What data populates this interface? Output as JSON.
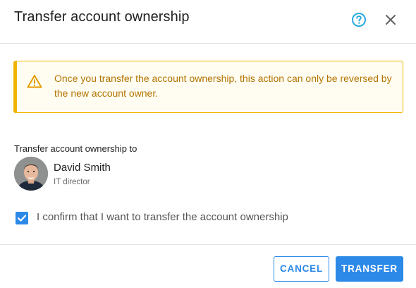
{
  "dialog": {
    "title": "Transfer account ownership",
    "help_icon": "help-circle-icon",
    "close_icon": "close-icon"
  },
  "warning": {
    "icon": "warning-triangle-icon",
    "text": "Once you transfer the account ownership, this action can only be reversed by the new account owner."
  },
  "recipient": {
    "section_label": "Transfer account ownership to",
    "name": "David Smith",
    "role": "IT director"
  },
  "confirm": {
    "label": "I confirm that I want to transfer the account ownership",
    "checked": true
  },
  "actions": {
    "cancel_label": "CANCEL",
    "transfer_label": "TRANSFER"
  },
  "colors": {
    "accent": "#2c89e8",
    "warning_border": "#f0b400",
    "warning_text": "#b37400",
    "help_icon": "#29a9dd"
  }
}
